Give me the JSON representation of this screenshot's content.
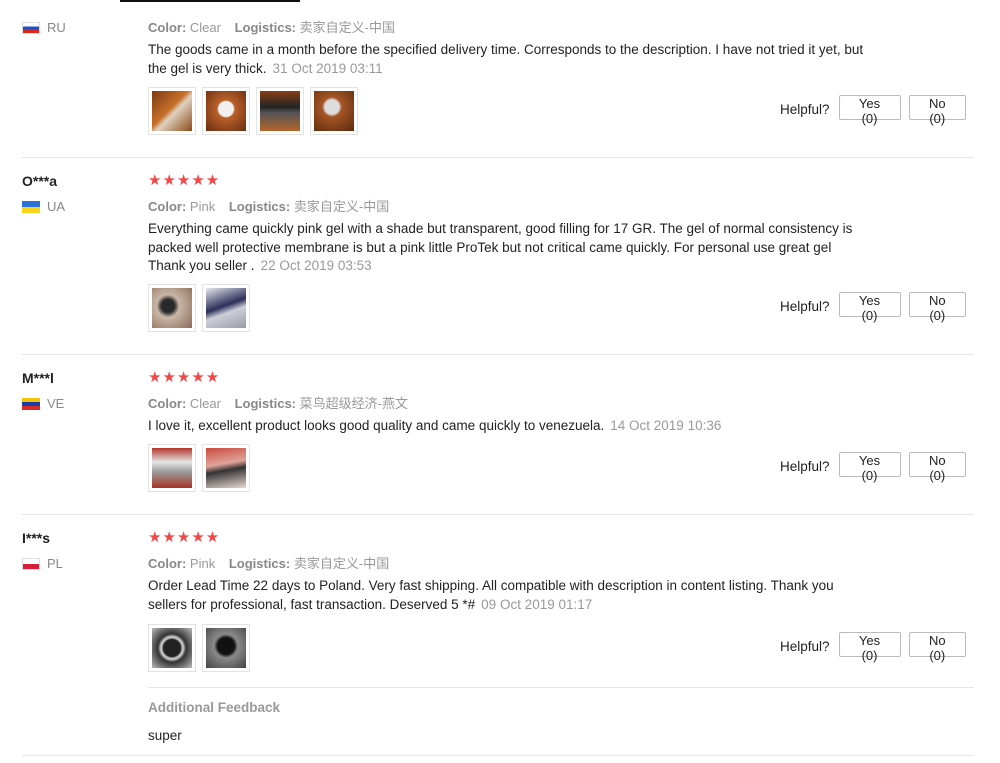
{
  "labels": {
    "color": "Color:",
    "logistics": "Logistics:",
    "helpful": "Helpful?",
    "additional_feedback": "Additional Feedback"
  },
  "colors": {
    "star": "#f44848",
    "meta_gray": "#999999",
    "separator": "#e6e6e6"
  },
  "reviews": [
    {
      "user": "",
      "country": "RU",
      "stars": "★★★★★",
      "color": "Clear",
      "logistics": "卖家自定义-中国",
      "text": "The goods came in a month before the specified delivery time. Corresponds to the description. I have not tried it yet, but the gel is very thick.",
      "date": "31 Oct 2019 03:11",
      "yes": "Yes (0)",
      "no": "No (0)"
    },
    {
      "user": "O***a",
      "country": "UA",
      "stars": "★★★★★",
      "color": "Pink",
      "logistics": "卖家自定义-中国",
      "text": "Everything came quickly pink gel with a shade but transparent, good filling for 17 GR. The gel of normal consistency is packed well protective membrane is but a pink little ProTek but not critical came quickly. For personal use great gel Thank you seller .",
      "date": "22 Oct 2019 03:53",
      "yes": "Yes (0)",
      "no": "No (0)"
    },
    {
      "user": "M***l",
      "country": "VE",
      "stars": "★★★★★",
      "color": "Clear",
      "logistics": "菜鸟超级经济-燕文",
      "text": "I love it, excellent product looks good quality and came quickly to venezuela.",
      "date": "14 Oct 2019 10:36",
      "yes": "Yes (0)",
      "no": "No (0)"
    },
    {
      "user": "I***s",
      "country": "PL",
      "stars": "★★★★★",
      "color": "Pink",
      "logistics": "卖家自定义-中国",
      "text": "Order Lead Time 22 days to Poland. Very fast shipping. All compatible with description in content listing. Thank you sellers for professional, fast transaction. Deserved 5 *#",
      "date": "09 Oct 2019 01:17",
      "yes": "Yes (0)",
      "no": "No (0)",
      "additional_feedback": "super"
    }
  ]
}
